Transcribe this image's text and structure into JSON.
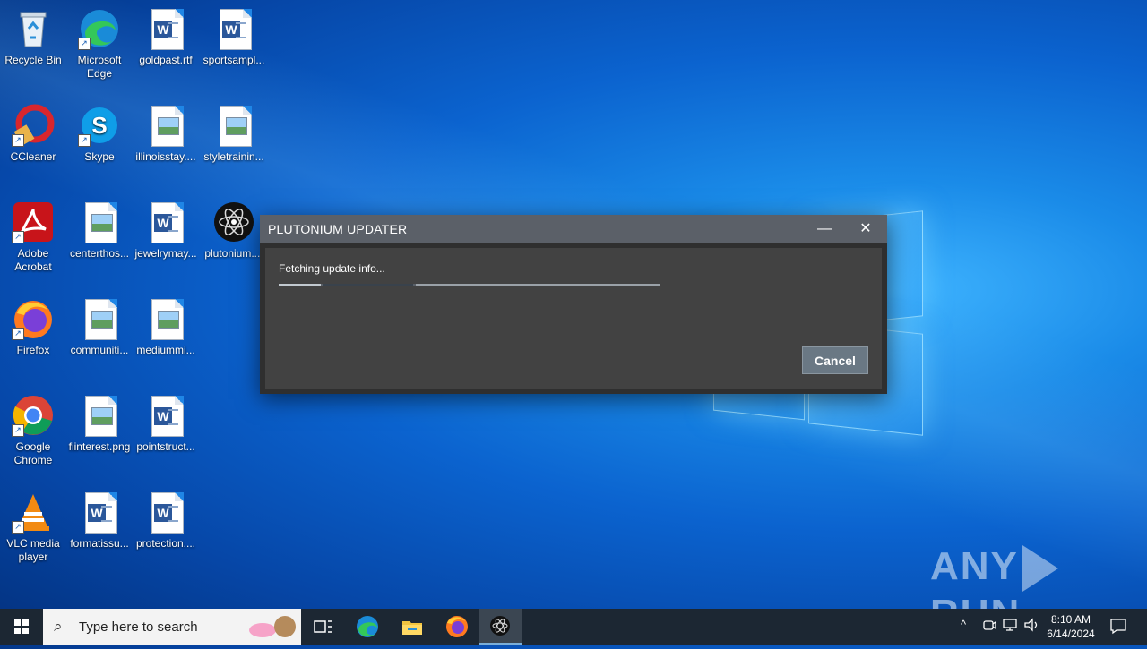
{
  "desktop": {
    "icons": [
      {
        "label": "Recycle Bin",
        "kind": "recycle-bin"
      },
      {
        "label": "Microsoft Edge",
        "kind": "edge"
      },
      {
        "label": "goldpast.rtf",
        "kind": "word"
      },
      {
        "label": "sportsampl...",
        "kind": "word"
      },
      {
        "label": "CCleaner",
        "kind": "ccleaner"
      },
      {
        "label": "Skype",
        "kind": "skype"
      },
      {
        "label": "illinoisstay....",
        "kind": "image"
      },
      {
        "label": "styletrainin...",
        "kind": "image"
      },
      {
        "label": "Adobe Acrobat",
        "kind": "acrobat"
      },
      {
        "label": "centerthos...",
        "kind": "image"
      },
      {
        "label": "jewelrymay...",
        "kind": "word"
      },
      {
        "label": "plutonium....",
        "kind": "plutonium"
      },
      {
        "label": "Firefox",
        "kind": "firefox"
      },
      {
        "label": "communiti...",
        "kind": "image"
      },
      {
        "label": "mediummi...",
        "kind": "image"
      },
      {
        "label": "Google Chrome",
        "kind": "chrome"
      },
      {
        "label": "fiinterest.png",
        "kind": "image"
      },
      {
        "label": "pointstruct...",
        "kind": "word"
      },
      {
        "label": "VLC media player",
        "kind": "vlc"
      },
      {
        "label": "formatissu...",
        "kind": "word"
      },
      {
        "label": "protection....",
        "kind": "word"
      }
    ]
  },
  "dialog": {
    "title": "PLUTONIUM UPDATER",
    "minimize_symbol": "—",
    "close_symbol": "✕",
    "status": "Fetching update info...",
    "cancel_label": "Cancel"
  },
  "watermark": {
    "left": "ANY",
    "right": "RUN"
  },
  "taskbar": {
    "search_placeholder": "Type here to search",
    "time": "8:10 AM",
    "date": "6/14/2024",
    "tray_icons": [
      "chevron-up-icon",
      "meet-now-icon",
      "network-icon",
      "volume-icon"
    ],
    "apps": [
      "task-view-icon",
      "edge-icon",
      "file-explorer-icon",
      "firefox-icon",
      "plutonium-icon"
    ]
  },
  "colors": {
    "accent": "#0b63cf",
    "dialog_title_bg": "#5b6068",
    "dialog_body_bg": "#424242",
    "cancel_bg": "#6a7884",
    "taskbar_bg": "#1c2733"
  }
}
